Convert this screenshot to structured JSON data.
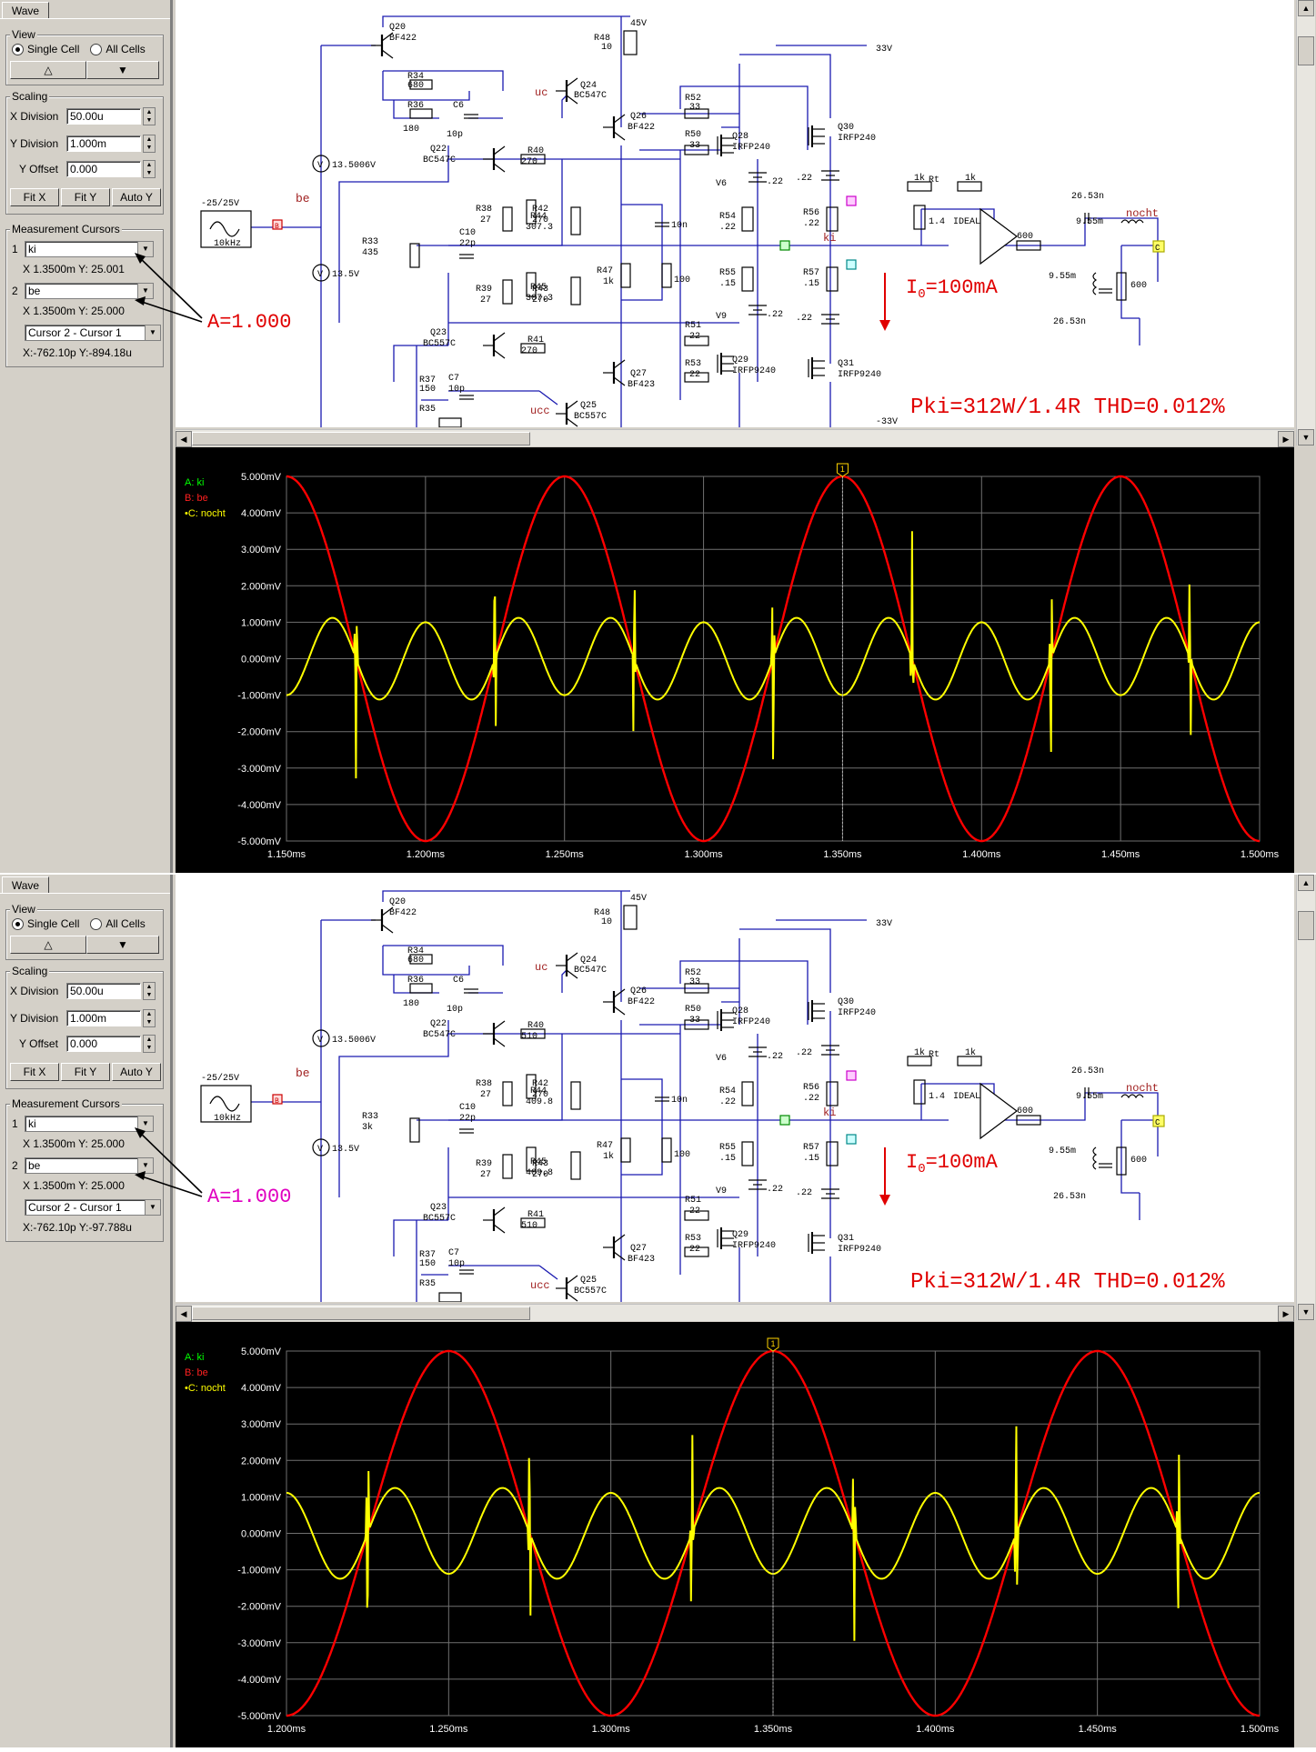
{
  "panes": [
    {
      "side": {
        "tab": "Wave",
        "view_title": "View",
        "single_cell": "Single Cell",
        "all_cells": "All Cells",
        "up_glyph": "△",
        "down_glyph": "▼",
        "scaling_title": "Scaling",
        "x_div_label": "X Division",
        "x_div": "50.00u",
        "y_div_label": "Y Division",
        "y_div": "1.000m",
        "y_off_label": "Y Offset",
        "y_off": "0.000",
        "fitx": "Fit X",
        "fity": "Fit Y",
        "autoy": "Auto Y",
        "cursors_title": "Measurement Cursors",
        "c1_num": "1",
        "c1_sel": "ki",
        "c1_xy": "X 1.3500m  Y: 25.001",
        "c2_num": "2",
        "c2_sel": "be",
        "c2_xy": "X 1.3500m  Y: 25.000",
        "diff_sel": "Cursor 2 - Cursor 1",
        "diff_xy": "X:-762.10p  Y:-894.18u"
      },
      "annotation": "A=1.000",
      "annotation_color": "#e00000",
      "schematic": {
        "pki": "Pki=312W/1.4R THD=0.012%",
        "io": "I",
        "io_sub": "0",
        "io_val": "=100mA",
        "v45": "45V",
        "v33": "33V",
        "vm33": "-33V",
        "src_label": "-25/25V",
        "src_freq": "10kHz",
        "be": "be",
        "v1": "13.5006V",
        "v2": "13.5V",
        "uc": "uc",
        "ucc": "ucc",
        "ki": "ki",
        "nocht": "nocht",
        "ideal": "IDEAL",
        "r33_val": "435",
        "r40_val": "270",
        "r41_val": "270",
        "r44_val": "307.3",
        "r45_val": "307.3",
        "q22_type": "BC547C",
        "q23_type": "BC557C"
      },
      "chart_data": {
        "type": "line",
        "x_range": [
          1.15,
          1.5
        ],
        "xlim": [
          1.15,
          1.5
        ],
        "ylim": [
          -5.0,
          5.0
        ],
        "x_ticks": [
          "1.150ms",
          "1.200ms",
          "1.250ms",
          "1.300ms",
          "1.350ms",
          "1.400ms",
          "1.450ms",
          "1.500ms"
        ],
        "y_ticks": [
          "5.000mV",
          "4.000mV",
          "3.000mV",
          "2.000mV",
          "1.000mV",
          "0.000mV",
          "-1.000mV",
          "-2.000mV",
          "-3.000mV",
          "-4.000mV",
          "-5.000mV"
        ],
        "legend": [
          "A: ki",
          "B: be",
          "•C: nocht"
        ],
        "legend_colors": [
          "#00ff00",
          "#ff2020",
          "#ffff00"
        ],
        "grid": true,
        "cursor_x": 1.35,
        "cursor_label": "1",
        "series": [
          {
            "name": "be",
            "color": "#ff0000",
            "kind": "sine",
            "amplitude": 5.0,
            "period": 0.1,
            "peak_at": 1.15
          },
          {
            "name": "nocht",
            "color": "#ffff00",
            "kind": "distortion",
            "amplitude": 1.35,
            "period": 0.1,
            "peak_at": 1.15,
            "spike_amplitude": 3.5
          }
        ]
      }
    },
    {
      "side": {
        "tab": "Wave",
        "view_title": "View",
        "single_cell": "Single Cell",
        "all_cells": "All Cells",
        "up_glyph": "△",
        "down_glyph": "▼",
        "scaling_title": "Scaling",
        "x_div_label": "X Division",
        "x_div": "50.00u",
        "y_div_label": "Y Division",
        "y_div": "1.000m",
        "y_off_label": "Y Offset",
        "y_off": "0.000",
        "fitx": "Fit X",
        "fity": "Fit Y",
        "autoy": "Auto Y",
        "cursors_title": "Measurement Cursors",
        "c1_num": "1",
        "c1_sel": "ki",
        "c1_xy": "X 1.3500m  Y: 25.000",
        "c2_num": "2",
        "c2_sel": "be",
        "c2_xy": "X 1.3500m  Y: 25.000",
        "diff_sel": "Cursor 2 - Cursor 1",
        "diff_xy": "X:-762.10p  Y:-97.788u"
      },
      "annotation": "A=1.000",
      "annotation_color": "#e000c0",
      "schematic": {
        "pki": "Pki=312W/1.4R THD=0.012%",
        "io": "I",
        "io_sub": "0",
        "io_val": "=100mA",
        "v45": "45V",
        "v33": "33V",
        "vm33": "",
        "src_label": "-25/25V",
        "src_freq": "10kHz",
        "be": "be",
        "v1": "13.5006V",
        "v2": "13.5V",
        "uc": "uc",
        "ucc": "ucc",
        "ki": "ki",
        "nocht": "nocht",
        "ideal": "IDEAL",
        "r33_val": "3k",
        "r40_val": "510",
        "r41_val": "510",
        "r44_val": "409.8",
        "r45_val": "409.8",
        "q22_type": "BC547C",
        "q23_type": "BC557C"
      },
      "chart_data": {
        "type": "line",
        "x_range": [
          1.2,
          1.5
        ],
        "xlim": [
          1.2,
          1.5
        ],
        "ylim": [
          -5.0,
          5.0
        ],
        "x_ticks": [
          "1.200ms",
          "1.250ms",
          "1.300ms",
          "1.350ms",
          "1.400ms",
          "1.450ms",
          "1.500ms"
        ],
        "y_ticks": [
          "5.000mV",
          "4.000mV",
          "3.000mV",
          "2.000mV",
          "1.000mV",
          "0.000mV",
          "-1.000mV",
          "-2.000mV",
          "-3.000mV",
          "-4.000mV",
          "-5.000mV"
        ],
        "legend": [
          "A: ki",
          "B: be",
          "•C: nocht"
        ],
        "legend_colors": [
          "#00ff00",
          "#ff2020",
          "#ffff00"
        ],
        "grid": true,
        "cursor_x": 1.35,
        "cursor_label": "1",
        "series": [
          {
            "name": "be",
            "color": "#ff0000",
            "kind": "sine",
            "amplitude": 5.0,
            "period": 0.1,
            "peak_at": 1.25
          },
          {
            "name": "nocht",
            "color": "#ffff00",
            "kind": "distortion",
            "amplitude": 1.5,
            "period": 0.1,
            "peak_at": 1.25,
            "spike_amplitude": 3.5
          }
        ]
      }
    }
  ]
}
